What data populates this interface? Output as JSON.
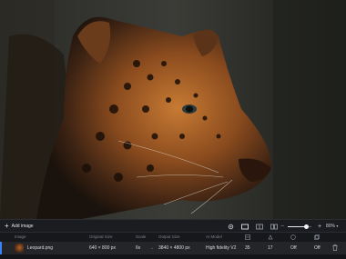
{
  "toolbar": {
    "add_label": "Add image",
    "zoom_label": "80%",
    "zoom_level": 0.8
  },
  "table": {
    "headers": [
      "Image",
      "Original Size",
      "Scale",
      "Output Size",
      "AI Model"
    ],
    "row": {
      "name": "Leopard.png",
      "original_size": "640 × 800 px",
      "scale": "6x",
      "output_size": "3840 × 4800 px",
      "model": "High fidelity V2",
      "val1": "35",
      "val2": "17",
      "val3": "Off",
      "val4": "Off"
    }
  },
  "icons": {
    "add": "plus-icon",
    "compare": "compare-icon",
    "single_view": "single-view-icon",
    "split_view": "split-view-icon",
    "side_view": "side-by-side-icon",
    "zoom_out": "minus-icon",
    "zoom_in": "plus-icon",
    "delete": "trash-icon"
  },
  "colors": {
    "accent": "#3b82f6",
    "background": "#151619"
  }
}
